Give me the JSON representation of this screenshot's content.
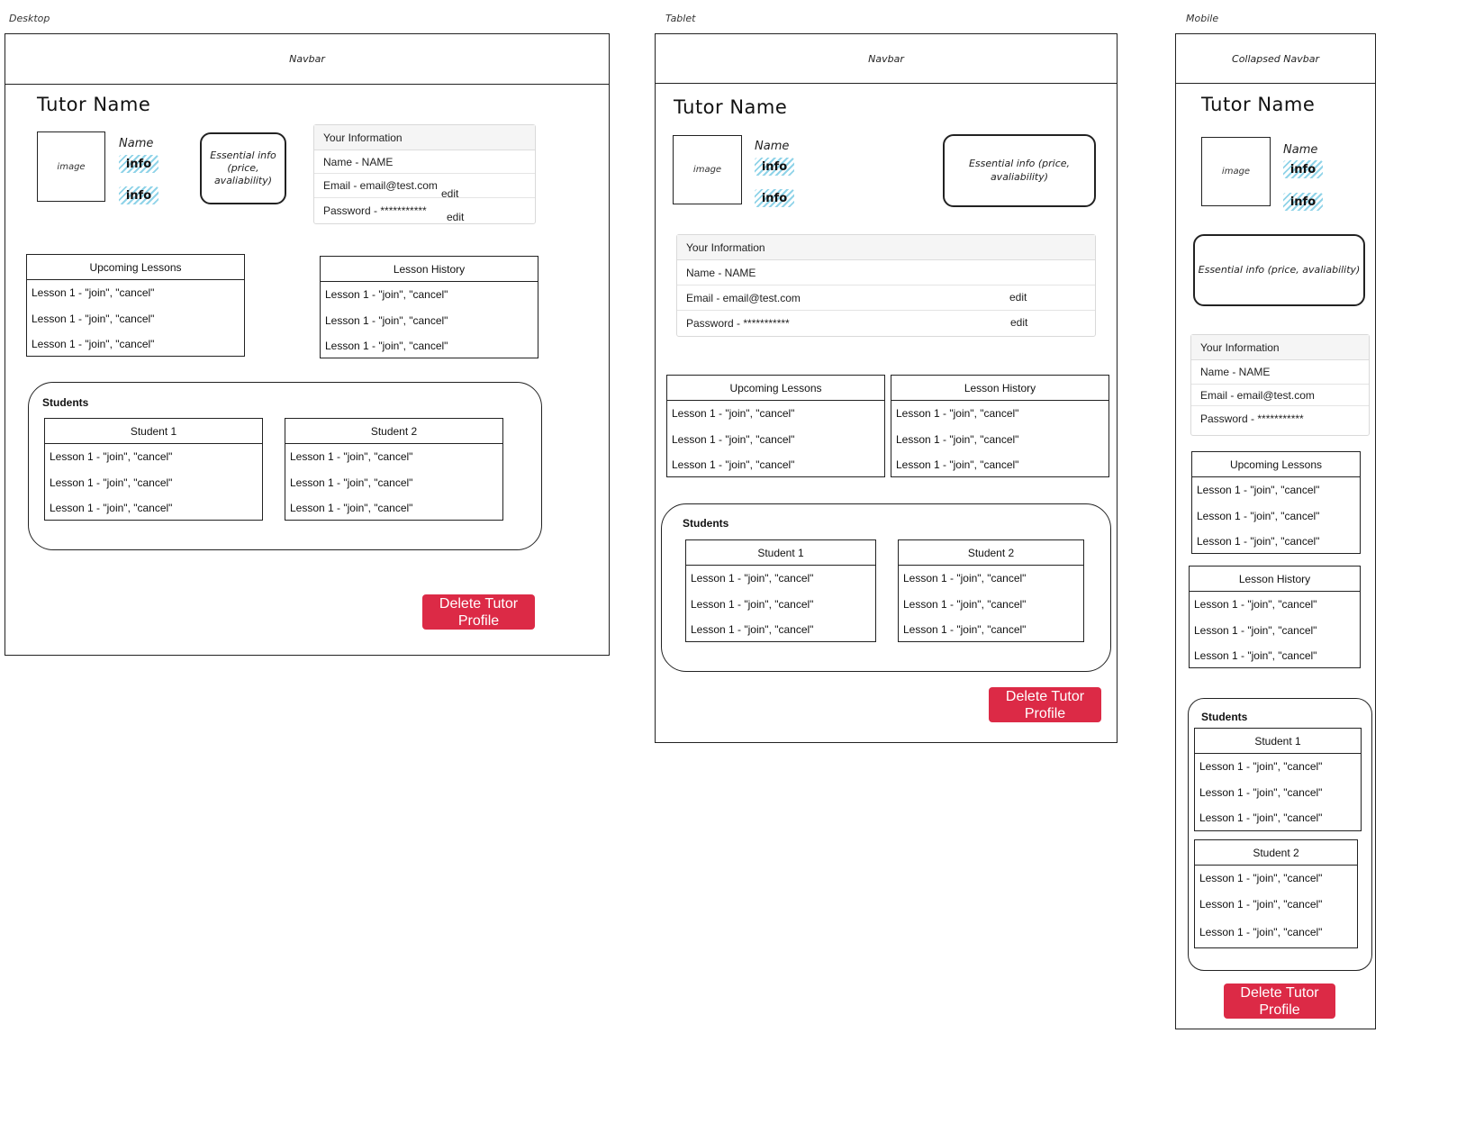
{
  "labels": {
    "desktop": "Desktop",
    "tablet": "Tablet",
    "mobile": "Mobile"
  },
  "navbar": {
    "full": "Navbar",
    "collapsed": "Collapsed Navbar"
  },
  "profile": {
    "tutor_name": "Tutor Name",
    "image": "image",
    "name_label": "Name",
    "info_tag": "info",
    "essential_two_line_1": "Essential info",
    "essential_two_line_2": "(price, avaliability)",
    "essential_one_line": "Essential info (price, avaliability)"
  },
  "your_info": {
    "header": "Your Information",
    "name_row": "Name - NAME",
    "email_row": "Email - email@test.com",
    "password_row": "Password - ***********",
    "edit": "edit"
  },
  "lessons": {
    "upcoming_title": "Upcoming Lessons",
    "history_title": "Lesson History",
    "item": "Lesson 1 - \"join\", \"cancel\""
  },
  "students": {
    "title": "Students",
    "student1": "Student 1",
    "student2": "Student 2"
  },
  "delete_button": {
    "line1": "Delete Tutor",
    "line2": "Profile"
  },
  "colors": {
    "delete": "#dc2a46",
    "info_hatch": "#8fd3e8",
    "stroke": "#222222"
  }
}
